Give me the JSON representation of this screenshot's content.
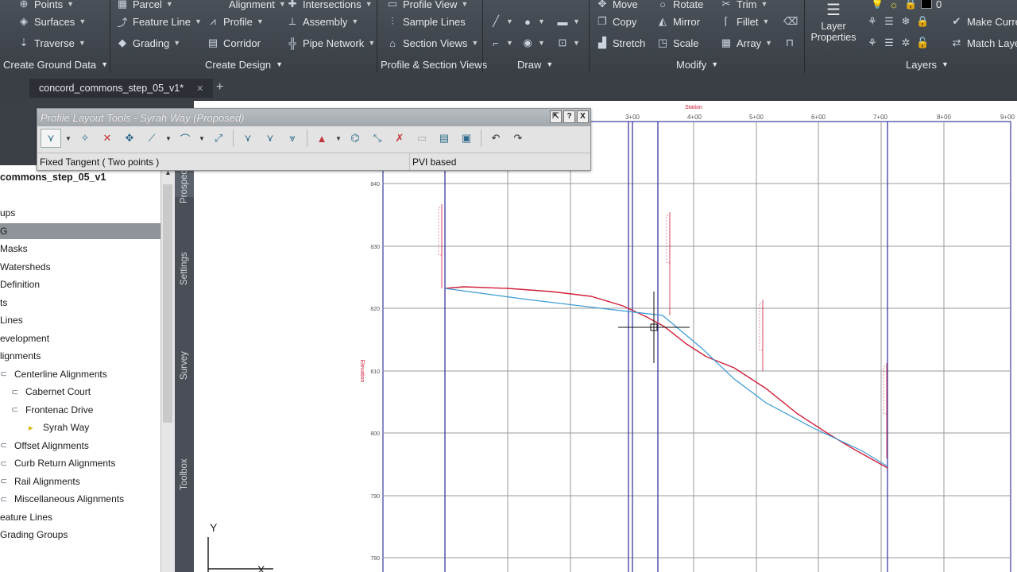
{
  "ribbon": {
    "create_ground_data": {
      "label": "Create Ground Data",
      "items": [
        {
          "icon": "points-icon",
          "label": "Points"
        },
        {
          "icon": "surfaces-icon",
          "label": "Surfaces"
        },
        {
          "icon": "traverse-icon",
          "label": "Traverse"
        }
      ]
    },
    "create_design": {
      "label": "Create Design",
      "items": [
        {
          "icon": "parcel-icon",
          "label": "Parcel"
        },
        {
          "icon": "alignment-icon",
          "label": "Alignment"
        },
        {
          "icon": "intersections-icon",
          "label": "Intersections"
        },
        {
          "icon": "feature-line-icon",
          "label": "Feature Line"
        },
        {
          "icon": "profile-icon",
          "label": "Profile"
        },
        {
          "icon": "assembly-icon",
          "label": "Assembly"
        },
        {
          "icon": "grading-icon",
          "label": "Grading"
        },
        {
          "icon": "corridor-icon",
          "label": "Corridor"
        },
        {
          "icon": "pipe-network-icon",
          "label": "Pipe Network"
        }
      ]
    },
    "profile_section_views": {
      "label": "Profile & Section Views",
      "items": [
        {
          "icon": "profile-view-icon",
          "label": "Profile View"
        },
        {
          "icon": "sample-lines-icon",
          "label": "Sample Lines"
        },
        {
          "icon": "section-views-icon",
          "label": "Section Views"
        }
      ]
    },
    "draw": {
      "label": "Draw"
    },
    "modify": {
      "label": "Modify",
      "items": [
        {
          "icon": "move-icon",
          "label": "Move"
        },
        {
          "icon": "rotate-icon",
          "label": "Rotate"
        },
        {
          "icon": "trim-icon",
          "label": "Trim"
        },
        {
          "icon": "copy-icon",
          "label": "Copy"
        },
        {
          "icon": "mirror-icon",
          "label": "Mirror"
        },
        {
          "icon": "fillet-icon",
          "label": "Fillet"
        },
        {
          "icon": "stretch-icon",
          "label": "Stretch"
        },
        {
          "icon": "scale-icon",
          "label": "Scale"
        },
        {
          "icon": "array-icon",
          "label": "Array"
        }
      ]
    },
    "layers": {
      "label": "Layers",
      "layer_properties": "Layer Properties",
      "layer_value": "0",
      "make_current": "Make Curre",
      "match_layer": "Match Laye"
    }
  },
  "tabs": {
    "doc": "concord_commons_step_05_v1*",
    "close": "✕",
    "plus": "+"
  },
  "plt": {
    "title": "Profile Layout Tools - Syrah Way (Proposed)",
    "btn_pin": "⇱",
    "btn_help": "?",
    "btn_close": "X",
    "status_left": "Fixed Tangent ( Two points )",
    "status_right": "PVI based"
  },
  "prospector": {
    "tabs": [
      "Prospector",
      "Settings",
      "Survey",
      "Toolbox"
    ],
    "drawing_title": "commons_step_05_v1",
    "items": [
      {
        "label": "ups",
        "indent": 0
      },
      {
        "label": "G",
        "indent": 0,
        "selected": true
      },
      {
        "label": "Masks",
        "indent": 0
      },
      {
        "label": "Watersheds",
        "indent": 0
      },
      {
        "label": "Definition",
        "indent": 0
      },
      {
        "label": "ts",
        "indent": 0
      },
      {
        "label": "Lines",
        "indent": 0
      },
      {
        "label": "evelopment",
        "indent": 0
      },
      {
        "label": "lignments",
        "indent": 0
      },
      {
        "label": "Centerline Alignments",
        "indent": 1
      },
      {
        "label": "Cabernet Court",
        "indent": 2
      },
      {
        "label": "Frontenac Drive",
        "indent": 2
      },
      {
        "label": "Syrah Way",
        "indent": 3
      },
      {
        "label": "Offset Alignments",
        "indent": 1
      },
      {
        "label": "Curb Return Alignments",
        "indent": 1
      },
      {
        "label": "Rail Alignments",
        "indent": 1
      },
      {
        "label": "Miscellaneous Alignments",
        "indent": 1
      },
      {
        "label": "eature Lines",
        "indent": 0
      },
      {
        "label": "Grading Groups",
        "indent": 0
      }
    ]
  },
  "profile_view": {
    "station_title": "Station",
    "elevation_label": "Elevation",
    "stations": [
      "3+00",
      "4+00",
      "5+00",
      "6+00",
      "7+00",
      "8+00",
      "9+00"
    ],
    "elevations": [
      "840",
      "830",
      "820",
      "810",
      "800",
      "790",
      "780"
    ],
    "colors": {
      "grid": "#9a9a9a",
      "axis": "#3a3aa0",
      "existing": "#d0203a",
      "proposed": "#3a9ad6",
      "cursor": "#111111"
    }
  },
  "ucs": {
    "y": "Y",
    "x": "X"
  }
}
